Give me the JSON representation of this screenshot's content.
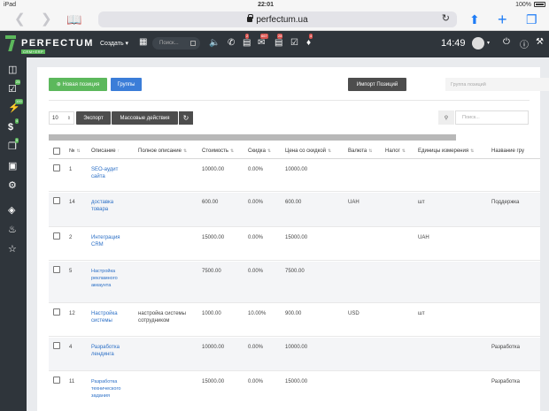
{
  "status_bar": {
    "device": "iPad",
    "time": "22:01",
    "battery": "100%"
  },
  "browser": {
    "url": "perfectum.ua"
  },
  "app": {
    "logo": "PERFECTUM",
    "logo_sub": "CRM+ERP",
    "create_label": "Создать",
    "search_placeholder": "Поиск...",
    "badges": {
      "tasks": "2",
      "mail": "667",
      "calendar": "28",
      "alerts": "4"
    },
    "clock": "14:49"
  },
  "sidebar": {
    "badges": {
      "tasks": "25",
      "deals": "100",
      "finance": "4",
      "docs": "5"
    }
  },
  "toolbar": {
    "new_position": "Новая позиция",
    "groups": "Группы",
    "import": "Импорт Позиций",
    "group_placeholder": "Группа позиций",
    "per_page": "10",
    "export": "Экспорт",
    "bulk_actions": "Массовые действия",
    "search_placeholder": "Поиск..."
  },
  "table": {
    "columns": [
      "№",
      "Описание",
      "Полное описание",
      "Стоимость",
      "Скидка",
      "Цена со скидкой",
      "Валюта",
      "Налог",
      "Единицы измерения",
      "Название гру"
    ],
    "rows": [
      {
        "num": "1",
        "desc": "SEO-аудит сайта",
        "full": "",
        "cost": "10000.00",
        "discount": "0.00%",
        "price": "10000.00",
        "currency": "",
        "tax": "",
        "unit": "",
        "group": ""
      },
      {
        "num": "14",
        "desc": "доставка товара",
        "full": "",
        "cost": "600.00",
        "discount": "0.00%",
        "price": "600.00",
        "currency": "UAH",
        "tax": "",
        "unit": "шт",
        "group": "Поддержка"
      },
      {
        "num": "2",
        "desc": "Интеграция CRM",
        "full": "",
        "cost": "15000.00",
        "discount": "0.00%",
        "price": "15000.00",
        "currency": "",
        "tax": "",
        "unit": "UAH",
        "group": ""
      },
      {
        "num": "5",
        "desc": "Настройка рекламного аккаунта",
        "full": "",
        "cost": "7500.00",
        "discount": "0.00%",
        "price": "7500.00",
        "currency": "",
        "tax": "",
        "unit": "",
        "group": ""
      },
      {
        "num": "12",
        "desc": "Настройка системы",
        "full": "настройка системы сотрудником",
        "cost": "1000.00",
        "discount": "10.00%",
        "price": "900.00",
        "currency": "USD",
        "tax": "",
        "unit": "шт",
        "group": ""
      },
      {
        "num": "4",
        "desc": "Разработка лендинга",
        "full": "",
        "cost": "10000.00",
        "discount": "0.00%",
        "price": "10000.00",
        "currency": "",
        "tax": "",
        "unit": "",
        "group": "Разработка"
      },
      {
        "num": "11",
        "desc": "Разработка технического задания",
        "full": "",
        "cost": "15000.00",
        "discount": "0.00%",
        "price": "15000.00",
        "currency": "",
        "tax": "",
        "unit": "",
        "group": "Разработка"
      }
    ]
  }
}
